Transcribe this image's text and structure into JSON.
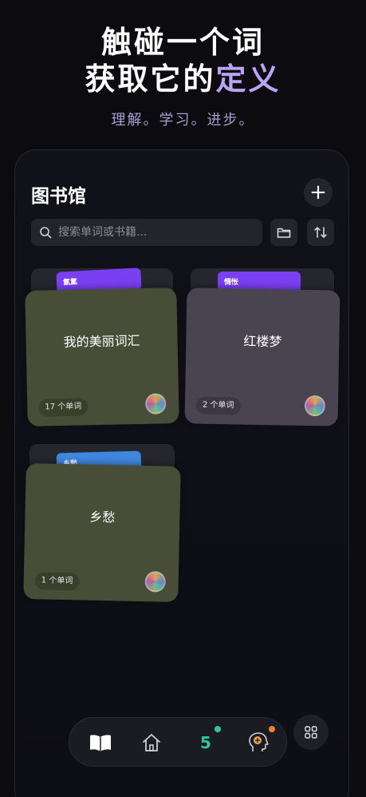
{
  "hero": {
    "line1": "触碰一个词",
    "line2_prefix": "获取它的",
    "line2_accent": "定义",
    "subtitle": "理解。学习。进步。"
  },
  "library": {
    "title": "图书馆",
    "add_label": "+",
    "search_placeholder": "搜索单词或书籍..."
  },
  "books": [
    {
      "name": "我的美丽词汇",
      "count": "17 个单词",
      "tab": "氤氲",
      "tab_color": "#7b3ff2",
      "cover_color": "#474d36"
    },
    {
      "name": "红楼梦",
      "count": "2 个单词",
      "tab": "惆怅",
      "tab_color": "#7b3ff2",
      "cover_color": "#4a4451"
    },
    {
      "name": "乡愁",
      "count": "1 个单词",
      "tab": "乡愁",
      "tab_color": "#3f86e0",
      "cover_color": "#474d36"
    }
  ],
  "nav": {
    "streak_count": "5"
  },
  "colors": {
    "accent": "#b9a3f5",
    "streak_green": "#2fc79a",
    "badge_orange": "#f0842c"
  }
}
